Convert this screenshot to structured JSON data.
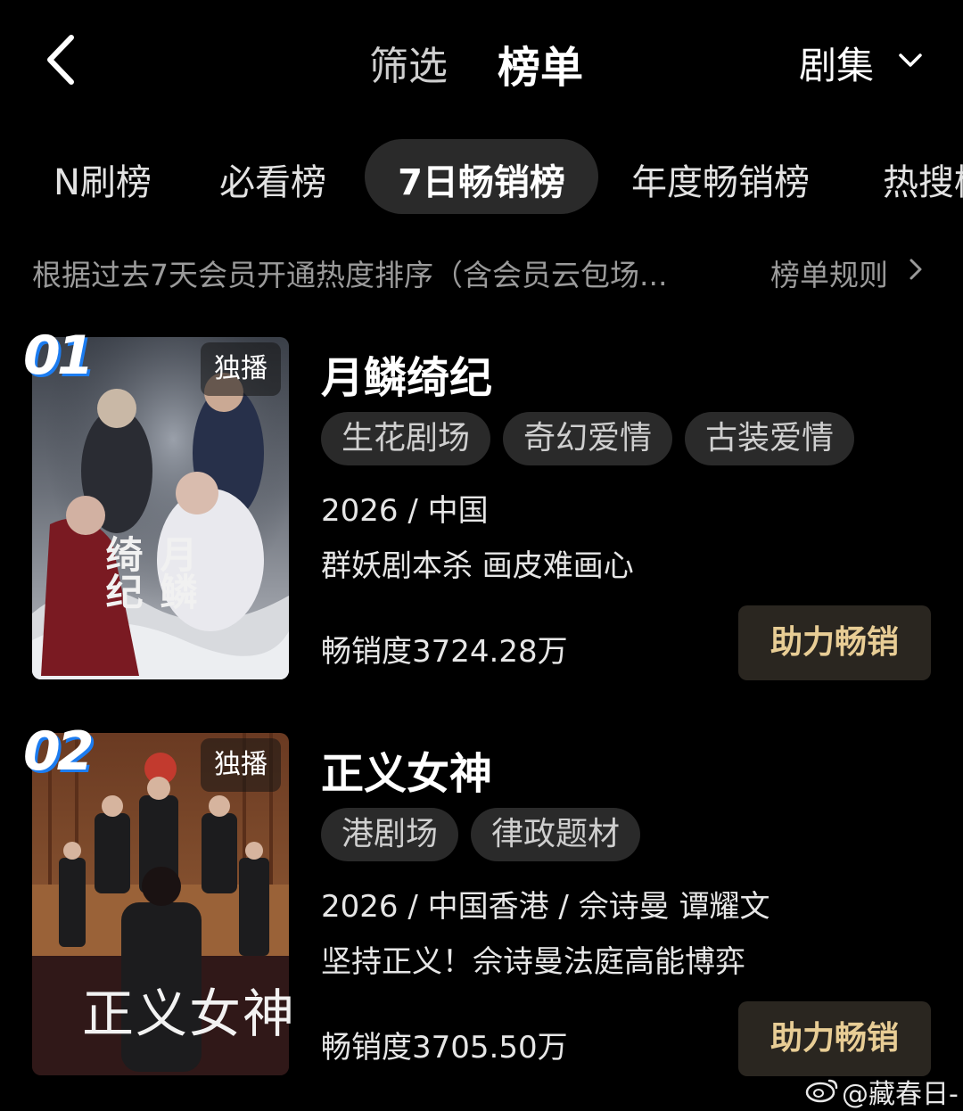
{
  "header": {
    "filter_label": "筛选",
    "ranking_label": "榜单",
    "category_label": "剧集"
  },
  "tabs": [
    {
      "label": "N刷榜"
    },
    {
      "label": "必看榜"
    },
    {
      "label": "7日畅销榜",
      "active": true
    },
    {
      "label": "年度畅销榜"
    },
    {
      "label": "热搜榜"
    }
  ],
  "description": "根据过去7天会员开通热度排序（含会员云包场...",
  "rules_label": "榜单规则",
  "items": [
    {
      "rank": "01",
      "badge": "独播",
      "poster_title": "月鳞绮纪",
      "title": "月鳞绮纪",
      "tags": [
        "生花剧场",
        "奇幻爱情",
        "古装爱情"
      ],
      "meta": "2026 / 中国",
      "subtitle": "群妖剧本杀 画皮难画心",
      "sales": "畅销度3724.28万",
      "button_label": "助力畅销"
    },
    {
      "rank": "02",
      "badge": "独播",
      "poster_title": "正义女神",
      "title": "正义女神",
      "tags": [
        "港剧场",
        "律政题材"
      ],
      "meta": "2026 / 中国香港 / 佘诗曼 谭耀文",
      "subtitle": "坚持正义！佘诗曼法庭高能博弈",
      "sales": "畅销度3705.50万",
      "button_label": "助力畅销"
    }
  ],
  "watermark": "@藏春日-",
  "colors": {
    "background": "#000000",
    "tag_bg": "#2a2a2a",
    "button_bg": "#2a2620",
    "button_text": "#e8cd95",
    "rank_accent": "#1c7cf0"
  }
}
